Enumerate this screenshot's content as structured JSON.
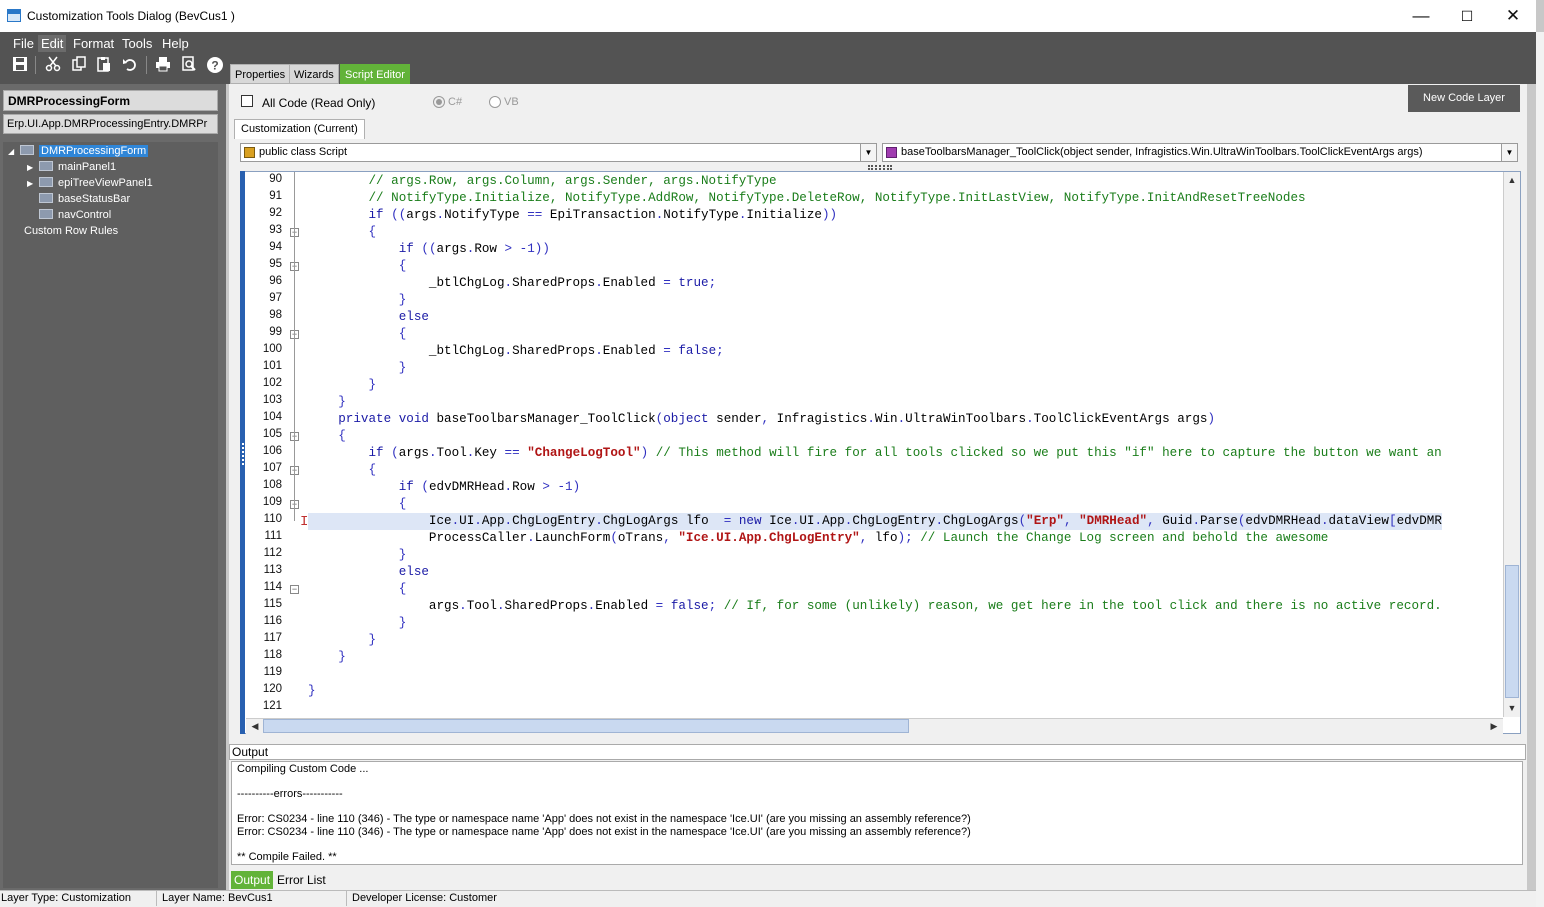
{
  "window": {
    "title": "Customization Tools Dialog  (BevCus1 )",
    "minimize": "—",
    "maximize": "☐",
    "close": "✕"
  },
  "menu": [
    "File",
    "Edit",
    "Format",
    "Tools",
    "Help"
  ],
  "toolbar_icons": [
    "save-icon",
    "cut-icon",
    "copy-icon",
    "paste-icon",
    "undo-icon",
    "print-icon",
    "print-preview-icon",
    "help-icon"
  ],
  "left": {
    "form_title": "DMRProcessingForm",
    "form_class": "Erp.UI.App.DMRProcessingEntry.DMRPr",
    "tree": [
      {
        "label": "DMRProcessingForm",
        "selected": true
      },
      {
        "label": "mainPanel1"
      },
      {
        "label": "epiTreeViewPanel1"
      },
      {
        "label": "baseStatusBar"
      },
      {
        "label": "navControl"
      },
      {
        "label": "Custom Row Rules"
      }
    ]
  },
  "tabs": [
    "Properties",
    "Wizards",
    "Script Editor"
  ],
  "options": {
    "all_code": "All Code (Read Only)",
    "csharp": "C#",
    "vb": "VB",
    "new_code_layer": "New Code Layer"
  },
  "subtab": "Customization (Current)",
  "combos": {
    "left": "public class Script",
    "right": "baseToolbarsManager_ToolClick(object sender, Infragistics.Win.UltraWinToolbars.ToolClickEventArgs args)"
  },
  "code_lines": [
    {
      "n": "90",
      "t": "        // args.Row, args.Column, args.Sender, args.NotifyType"
    },
    {
      "n": "91",
      "t": "        // NotifyType.Initialize, NotifyType.AddRow, NotifyType.DeleteRow, NotifyType.InitLastView, NotifyType.InitAndResetTreeNodes"
    },
    {
      "n": "92",
      "t": "        if ((args.NotifyType == EpiTransaction.NotifyType.Initialize))"
    },
    {
      "n": "93",
      "t": "        {"
    },
    {
      "n": "94",
      "t": "            if ((args.Row > -1))"
    },
    {
      "n": "95",
      "t": "            {"
    },
    {
      "n": "96",
      "t": "                _btlChgLog.SharedProps.Enabled = true;"
    },
    {
      "n": "97",
      "t": "            }"
    },
    {
      "n": "98",
      "t": "            else"
    },
    {
      "n": "99",
      "t": "            {"
    },
    {
      "n": "100",
      "t": "                _btlChgLog.SharedProps.Enabled = false;"
    },
    {
      "n": "101",
      "t": "            }"
    },
    {
      "n": "102",
      "t": "        }"
    },
    {
      "n": "103",
      "t": "    }"
    },
    {
      "n": "104",
      "t": "    private void baseToolbarsManager_ToolClick(object sender, Infragistics.Win.UltraWinToolbars.ToolClickEventArgs args)"
    },
    {
      "n": "105",
      "t": "    {"
    },
    {
      "n": "106",
      "t": "        if (args.Tool.Key == \"ChangeLogTool\") // This method will fire for all tools clicked so we put this \"if\" here to capture the button we want an"
    },
    {
      "n": "107",
      "t": "        {"
    },
    {
      "n": "108",
      "t": "            if (edvDMRHead.Row > -1)"
    },
    {
      "n": "109",
      "t": "            {"
    },
    {
      "n": "110",
      "t": "                Ice.UI.App.ChgLogEntry.ChgLogArgs lfo  = new Ice.UI.App.ChgLogEntry.ChgLogArgs(\"Erp\", \"DMRHead\", Guid.Parse(edvDMRHead.dataView[edvDMR"
    },
    {
      "n": "111",
      "t": "                ProcessCaller.LaunchForm(oTrans, \"Ice.UI.App.ChgLogEntry\", lfo); // Launch the Change Log screen and behold the awesome"
    },
    {
      "n": "112",
      "t": "            }"
    },
    {
      "n": "113",
      "t": "            else"
    },
    {
      "n": "114",
      "t": "            {"
    },
    {
      "n": "115",
      "t": "                args.Tool.SharedProps.Enabled = false; // If, for some (unlikely) reason, we get here in the tool click and there is no active record."
    },
    {
      "n": "116",
      "t": "            }"
    },
    {
      "n": "117",
      "t": "        }"
    },
    {
      "n": "118",
      "t": "    }"
    },
    {
      "n": "119",
      "t": ""
    },
    {
      "n": "120",
      "t": "}"
    },
    {
      "n": "121",
      "t": ""
    }
  ],
  "output": {
    "label": "Output",
    "lines": [
      "Compiling Custom Code ...",
      "",
      "----------errors-----------",
      "",
      "Error: CS0234 - line 110 (346) - The type or namespace name 'App' does not exist in the namespace 'Ice.UI' (are you missing an assembly reference?)",
      "Error: CS0234 - line 110 (346) - The type or namespace name 'App' does not exist in the namespace 'Ice.UI' (are you missing an assembly reference?)",
      "",
      "** Compile Failed. **"
    ]
  },
  "bottom_tabs": [
    "Output",
    "Error List"
  ],
  "status": {
    "layer_type": "Layer Type:  Customization",
    "layer_name": "Layer Name:  BevCus1",
    "license": "Developer License:  Customer"
  },
  "colors": {
    "accent_green": "#62b339",
    "toolbar_gray": "#535353",
    "keyword_blue": "#1a1aa6",
    "comment_green": "#1a7d1a",
    "string_red": "#b01515"
  }
}
